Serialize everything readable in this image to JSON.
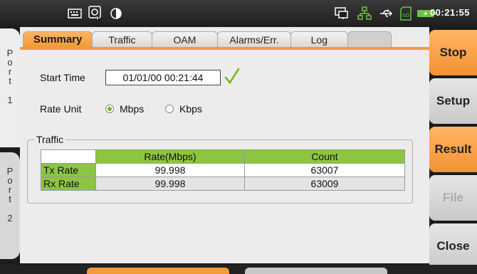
{
  "statusbar": {
    "clock": "00:21:55",
    "icons": [
      "keyboard-icon",
      "screenshot-icon",
      "contrast-icon",
      "remote-desktop-icon",
      "network-icon",
      "usb-icon",
      "sd-card-icon",
      "battery-charging-icon"
    ]
  },
  "ports": [
    {
      "letters": [
        "P",
        "o",
        "r",
        "t"
      ],
      "num": "1"
    },
    {
      "letters": [
        "P",
        "o",
        "r",
        "t"
      ],
      "num": "2"
    }
  ],
  "tabs": [
    "Summary",
    "Traffic",
    "OAM",
    "Alarms/Err.",
    "Log"
  ],
  "summary": {
    "start_time_label": "Start Time",
    "start_time_value": "01/01/00 00:21:44",
    "rate_unit_label": "Rate Unit",
    "rate_options": [
      "Mbps",
      "Kbps"
    ],
    "rate_selected": "Mbps"
  },
  "traffic": {
    "group_title": "Traffic",
    "headers": [
      "",
      "Rate(Mbps)",
      "Count"
    ],
    "rows": [
      {
        "label": "Tx Rate",
        "rate": "99.998",
        "count": "63007"
      },
      {
        "label": "Rx Rate",
        "rate": "99.998",
        "count": "63009"
      }
    ]
  },
  "side_buttons": {
    "stop": "Stop",
    "setup": "Setup",
    "result": "Result",
    "file": "File",
    "close": "Close"
  },
  "colors": {
    "accent_orange": "#f39a3a",
    "table_green": "#8cc542",
    "check_green": "#79b51c"
  }
}
